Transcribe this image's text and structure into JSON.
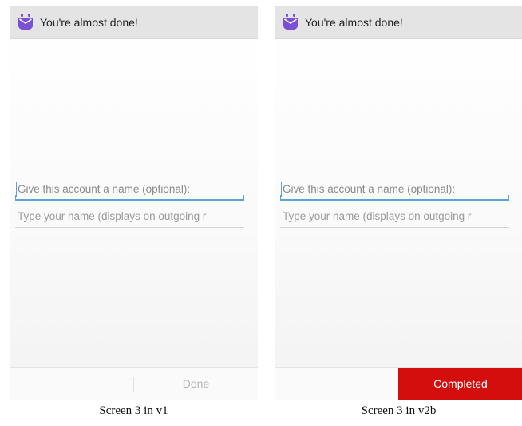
{
  "colors": {
    "app_icon": "#7b4fd6",
    "focus_underline": "#5aa3d6",
    "completed_bg": "#d40d0d",
    "done_text": "#b5b5b5"
  },
  "screens": [
    {
      "icon": "purple-mail-app-icon",
      "title": "You're almost done!",
      "account_name_placeholder": "Give this account a name (optional):",
      "display_name_placeholder": "Type your name (displays on outgoing r",
      "action_label": "Done",
      "caption": "Screen 3 in v1"
    },
    {
      "icon": "purple-mail-app-icon",
      "title": "You're almost done!",
      "account_name_placeholder": "Give this account a name (optional):",
      "display_name_placeholder": "Type your name (displays on outgoing r",
      "action_label": "Completed",
      "caption": "Screen 3 in v2b"
    }
  ]
}
